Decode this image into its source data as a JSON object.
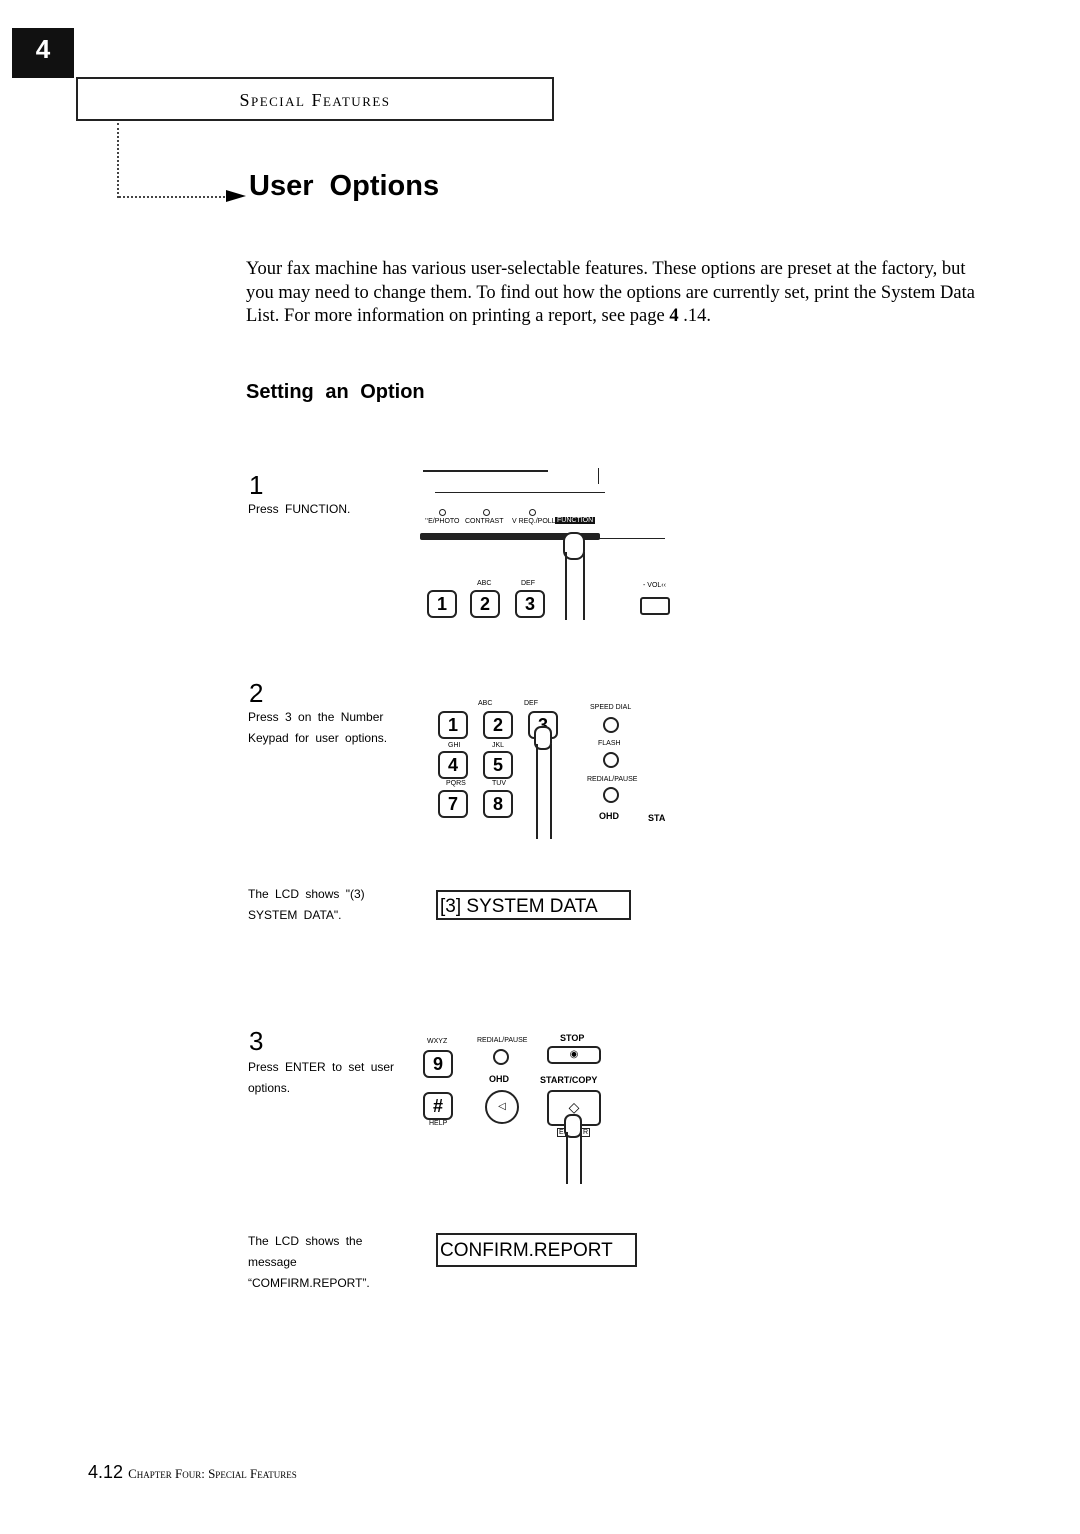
{
  "header": {
    "chapter_number": "4",
    "section_title": "Special Features"
  },
  "title": "User Options",
  "intro": {
    "text_before_bold": "Your fax machine has various user-selectable features. These options are preset at the factory, but you may need to change them. To find out how the options are currently set, print the System Data List. For more information on printing a report, see page ",
    "bold": "4",
    "text_after_bold": " .14."
  },
  "subheading": "Setting an Option",
  "steps": [
    {
      "number": "1",
      "caption": "Press FUNCTION.",
      "panel_labels": {
        "photo": "’‘E/PHOTO",
        "contrast": "CONTRAST",
        "poll": "V REQ./POLL",
        "function": "FUNCTION",
        "volume": "- VOL‹‹",
        "k1": "1",
        "k2": "2",
        "k3": "3",
        "abc": "ABC",
        "def": "DEF"
      }
    },
    {
      "number": "2",
      "caption": "Press 3 on the Number Keypad for user options.",
      "lcd_caption": "The LCD shows \"(3) SYSTEM DATA\".",
      "lcd": "[3] SYSTEM DATA",
      "panel_labels": {
        "k1": "1",
        "k2": "2",
        "k3": "3",
        "k4": "4",
        "k5": "5",
        "k7": "7",
        "k8": "8",
        "abc": "ABC",
        "def": "DEF",
        "ghi": "GHI",
        "jkl": "JKL",
        "pqrs": "PQRS",
        "tuv": "TUV",
        "speed_dial": "SPEED DIAL",
        "flash": "FLASH",
        "redial": "REDIAL/PAUSE",
        "ohd": "OHD",
        "sta": "STA"
      }
    },
    {
      "number": "3",
      "caption": "Press ENTER to set user options.",
      "lcd_caption": "The LCD shows the message “COMFIRM.REPORT”.",
      "lcd": "CONFIRM.REPORT",
      "panel_labels": {
        "wxyz": "WXYZ",
        "k9": "9",
        "hash": "#",
        "help": "HELP",
        "redial": "REDIAL/PAUSE",
        "ohd": "OHD",
        "stop": "STOP",
        "start": "START/COPY",
        "e": "E",
        "r": "R"
      }
    }
  ],
  "footer": {
    "page": "4.12",
    "text": "Chapter Four: Special Features"
  }
}
